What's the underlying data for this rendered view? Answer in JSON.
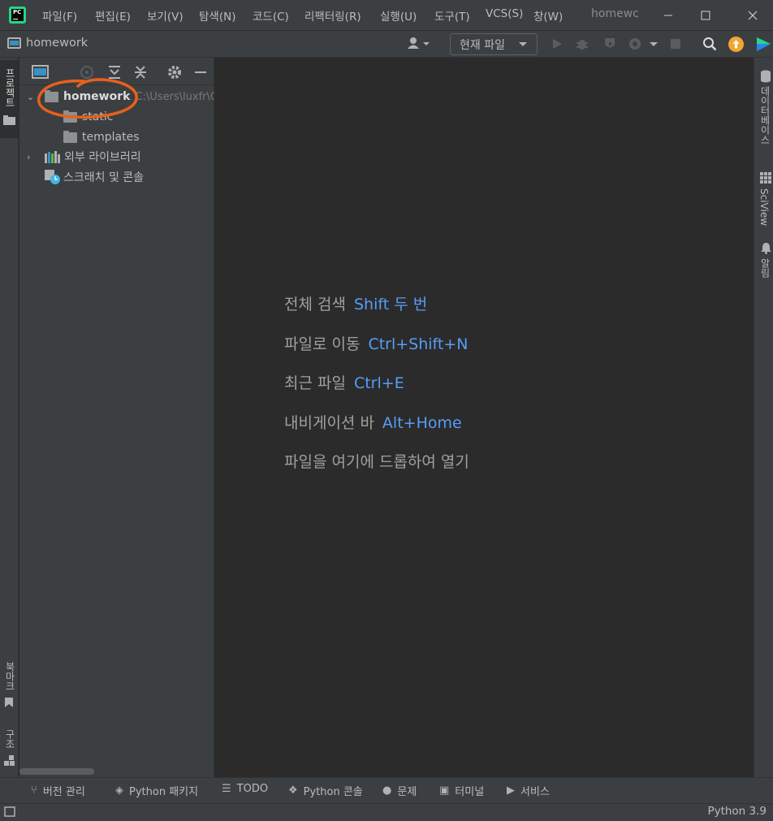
{
  "menu": [
    "파일(F)",
    "편집(E)",
    "보기(V)",
    "탐색(N)",
    "코드(C)",
    "리팩터링(R)",
    "실행(U)",
    "도구(T)",
    "VCS(S)",
    "창(W)"
  ],
  "window_title": "homewc",
  "app_logo_text": "PC",
  "navbar": {
    "project_name": "homework",
    "run_config": "현재 파일"
  },
  "left_strip": {
    "project_tab": "프로젝트",
    "bookmarks_tab": "북마크",
    "structure_tab": "구조"
  },
  "project_tree": {
    "root": {
      "name": "homework",
      "path": "C:\\Users\\luxfr\\C"
    },
    "children": [
      "static",
      "templates"
    ],
    "external_libraries": "외부 라이브러리",
    "scratches": "스크래치 및 콘솔"
  },
  "editor_hints": [
    {
      "label": "전체 검색",
      "key": "Shift 두 번"
    },
    {
      "label": "파일로 이동",
      "key": "Ctrl+Shift+N"
    },
    {
      "label": "최근 파일",
      "key": "Ctrl+E"
    },
    {
      "label": "내비게이션 바",
      "key": "Alt+Home"
    },
    {
      "label": "파일을 여기에 드롭하여 열기",
      "key": ""
    }
  ],
  "right_strip": {
    "database_tab": "데이터베이스",
    "sciview_tab": "SciView",
    "notifications_tab": "알림"
  },
  "bottom_tools": [
    {
      "icon": "version-control-icon",
      "label": "버전 관리"
    },
    {
      "icon": "python-packages-icon",
      "label": "Python 패키지"
    },
    {
      "icon": "todo-icon",
      "label": "TODO"
    },
    {
      "icon": "python-console-icon",
      "label": "Python 콘솔"
    },
    {
      "icon": "problems-icon",
      "label": "문제"
    },
    {
      "icon": "terminal-icon",
      "label": "터미널"
    },
    {
      "icon": "services-icon",
      "label": "서비스"
    }
  ],
  "status_bar": {
    "interpreter": "Python 3.9"
  },
  "colors": {
    "annotation": "#e8601c",
    "accent_blue": "#589df6",
    "update_badge": "#f0a732"
  }
}
